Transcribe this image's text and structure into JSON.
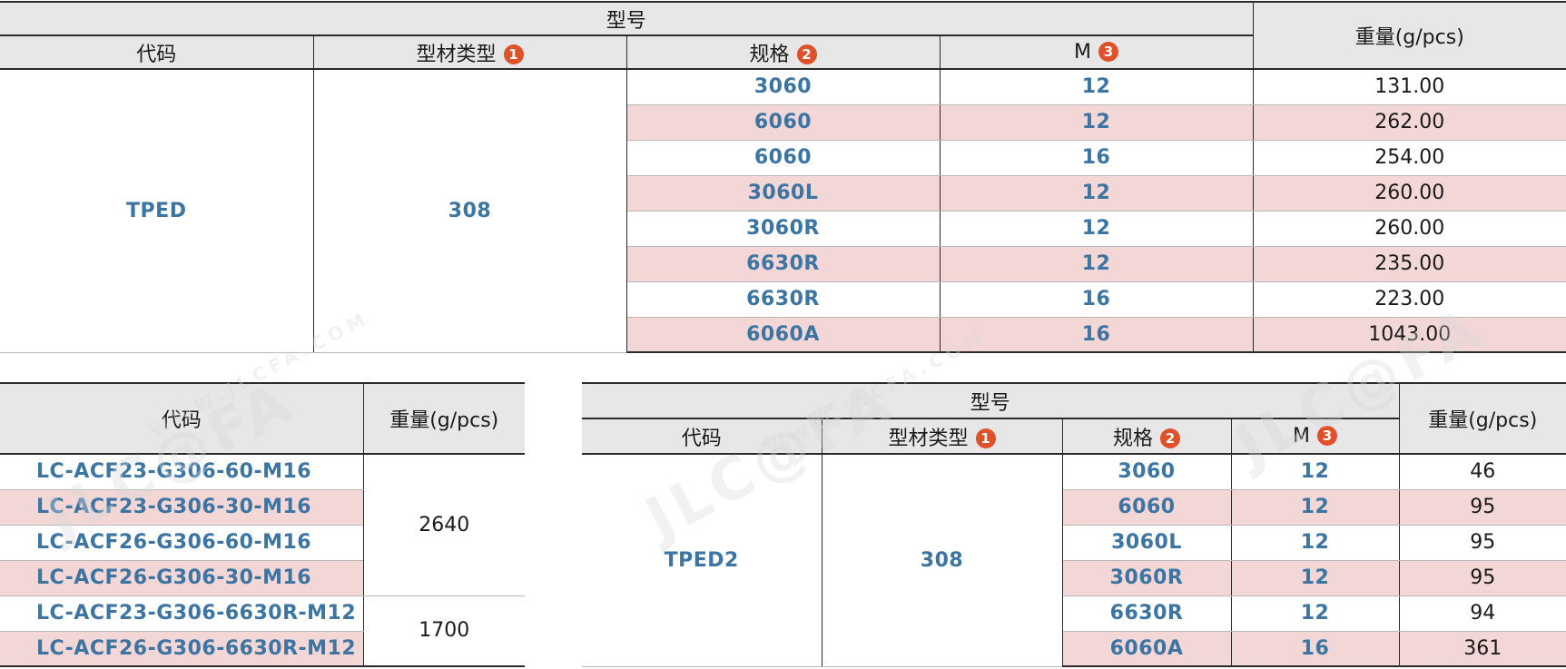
{
  "table1": {
    "group_header": "型号",
    "headers": {
      "code": "代码",
      "material": "型材类型",
      "spec": "规格",
      "m": "M",
      "weight": "重量(g/pcs)"
    },
    "badges": {
      "material": "1",
      "spec": "2",
      "m": "3"
    },
    "code_value": "TPED",
    "material_value": "308",
    "rows": [
      {
        "spec": "3060",
        "m": "12",
        "weight": "131.00"
      },
      {
        "spec": "6060",
        "m": "12",
        "weight": "262.00"
      },
      {
        "spec": "6060",
        "m": "16",
        "weight": "254.00"
      },
      {
        "spec": "3060L",
        "m": "12",
        "weight": "260.00"
      },
      {
        "spec": "3060R",
        "m": "12",
        "weight": "260.00"
      },
      {
        "spec": "6630R",
        "m": "12",
        "weight": "235.00"
      },
      {
        "spec": "6630R",
        "m": "16",
        "weight": "223.00"
      },
      {
        "spec": "6060A",
        "m": "16",
        "weight": "1043.00"
      }
    ]
  },
  "table2": {
    "headers": {
      "code": "代码",
      "weight": "重量(g/pcs)"
    },
    "codes": [
      "LC-ACF23-G306-60-M16",
      "LC-ACF23-G306-30-M16",
      "LC-ACF26-G306-60-M16",
      "LC-ACF26-G306-30-M16",
      "LC-ACF23-G306-6630R-M12",
      "LC-ACF26-G306-6630R-M12"
    ],
    "weights": [
      "2640",
      "1700"
    ]
  },
  "table3": {
    "group_header": "型号",
    "headers": {
      "code": "代码",
      "material": "型材类型",
      "spec": "规格",
      "m": "M",
      "weight": "重量(g/pcs)"
    },
    "badges": {
      "material": "1",
      "spec": "2",
      "m": "3"
    },
    "code_value": "TPED2",
    "material_value": "308",
    "rows": [
      {
        "spec": "3060",
        "m": "12",
        "weight": "46"
      },
      {
        "spec": "6060",
        "m": "12",
        "weight": "95"
      },
      {
        "spec": "3060L",
        "m": "12",
        "weight": "95"
      },
      {
        "spec": "3060R",
        "m": "12",
        "weight": "95"
      },
      {
        "spec": "6630R",
        "m": "12",
        "weight": "94"
      },
      {
        "spec": "6060A",
        "m": "16",
        "weight": "361"
      }
    ]
  },
  "watermark": {
    "brand": "JLC@FA",
    "url": "WWW.JLCFA.COM"
  },
  "colors": {
    "header_bg": "#e7e7e7",
    "stripe_pink": "#f3d6d6",
    "value_blue": "#3c74a2",
    "badge_orange": "#e0502a"
  }
}
